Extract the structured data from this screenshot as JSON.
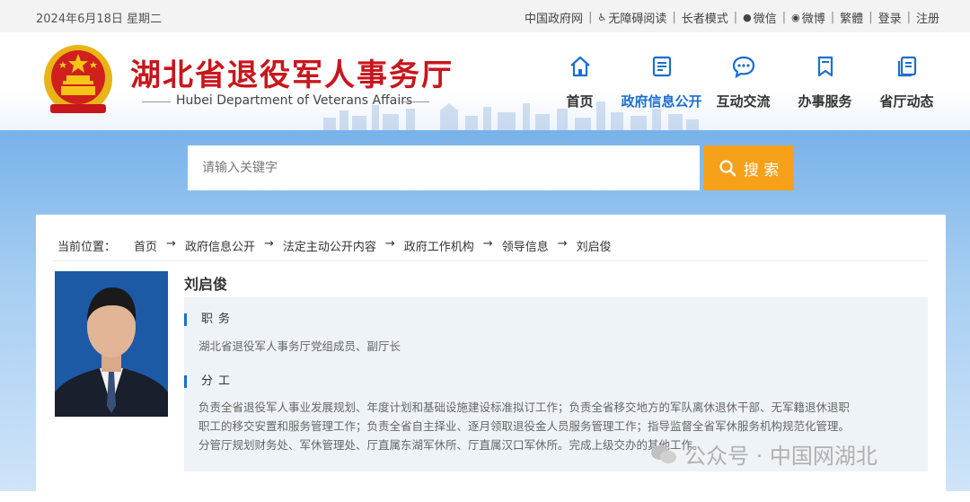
{
  "topbar": {
    "date": "2024年6月18日 星期二",
    "links": [
      {
        "label": "中国政府网"
      },
      {
        "label": "无障碍阅读",
        "icon": "♿"
      },
      {
        "label": "长者模式"
      },
      {
        "label": "微信",
        "icon": "●"
      },
      {
        "label": "微博",
        "icon": "◉"
      },
      {
        "label": "繁體"
      },
      {
        "label": "登录"
      },
      {
        "label": "注册"
      }
    ]
  },
  "header": {
    "title_cn": "湖北省退役军人事务厅",
    "title_en": "Hubei Department of Veterans Affairs",
    "brand_color": "#c8161d"
  },
  "nav": {
    "active_color": "#1a6fcf",
    "items": [
      {
        "label": "首页",
        "icon": "home-icon"
      },
      {
        "label": "政府信息公开",
        "icon": "document-icon",
        "active": true
      },
      {
        "label": "互动交流",
        "icon": "chat-icon"
      },
      {
        "label": "办事服务",
        "icon": "bookmark-icon"
      },
      {
        "label": "省厅动态",
        "icon": "news-icon"
      }
    ]
  },
  "search": {
    "placeholder": "请输入关键字",
    "button_label": "搜 索",
    "button_color": "#f7a11a"
  },
  "breadcrumb": {
    "label": "当前位置：",
    "items": [
      "首页",
      "政府信息公开",
      "法定主动公开内容",
      "政府工作机构",
      "领导信息",
      "刘启俊"
    ]
  },
  "profile": {
    "name": "刘启俊",
    "position_title": "职务",
    "position_text": "湖北省退役军人事务厅党组成员、副厅长",
    "duty_title": "分工",
    "duty_lines": [
      "负责全省退役军人事业发展规划、年度计划和基础设施建设标准拟订工作；负责全省移交地方的军队离休退休干部、无军籍退休退职",
      "职工的移交安置和服务管理工作；负责全省自主择业、逐月领取退役金人员服务管理工作；指导监督全省军休服务机构规范化管理。",
      "分管厅规划财务处、军休管理处、厅直属东湖军休所、厅直属汉口军休所。完成上级交办的其他工作。"
    ]
  },
  "watermark": {
    "text": "公众号 · 中国网湖北"
  }
}
